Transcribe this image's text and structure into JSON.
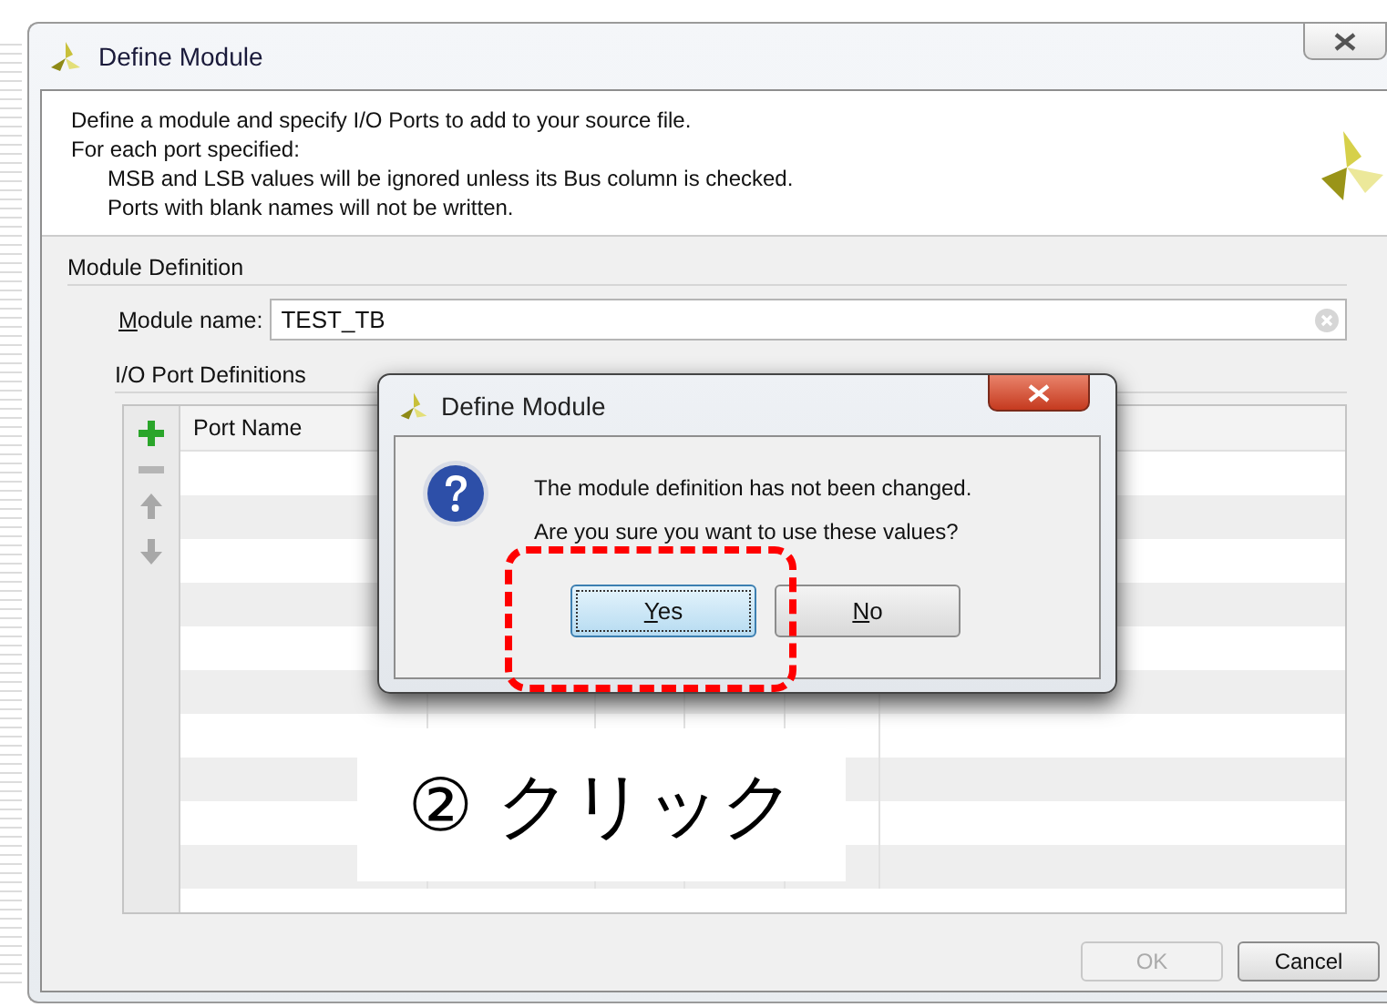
{
  "window": {
    "title": "Define Module"
  },
  "intro": {
    "lines": [
      "Define a module and specify I/O Ports to add to your source file.",
      "For each port specified:"
    ],
    "sub_lines": [
      "MSB and LSB values will be ignored unless its Bus column is checked.",
      "Ports with blank names will not be written."
    ]
  },
  "module_definition": {
    "heading": "Module Definition",
    "name_label": "Module name:",
    "name_value": "TEST_TB"
  },
  "ports": {
    "heading": "I/O Port Definitions",
    "columns": [
      "Port Name"
    ]
  },
  "buttons": [
    {
      "label": "OK",
      "disabled": true
    },
    {
      "label": "Cancel",
      "disabled": false
    }
  ],
  "dialog": {
    "title": "Define Module",
    "message_lines": [
      "The module definition has not been changed.",
      "Are you sure you want to use these values?"
    ],
    "buttons": [
      {
        "label": "Yes",
        "selected": true
      },
      {
        "label": "No",
        "selected": false
      }
    ]
  },
  "callout": {
    "text": "② クリック"
  }
}
